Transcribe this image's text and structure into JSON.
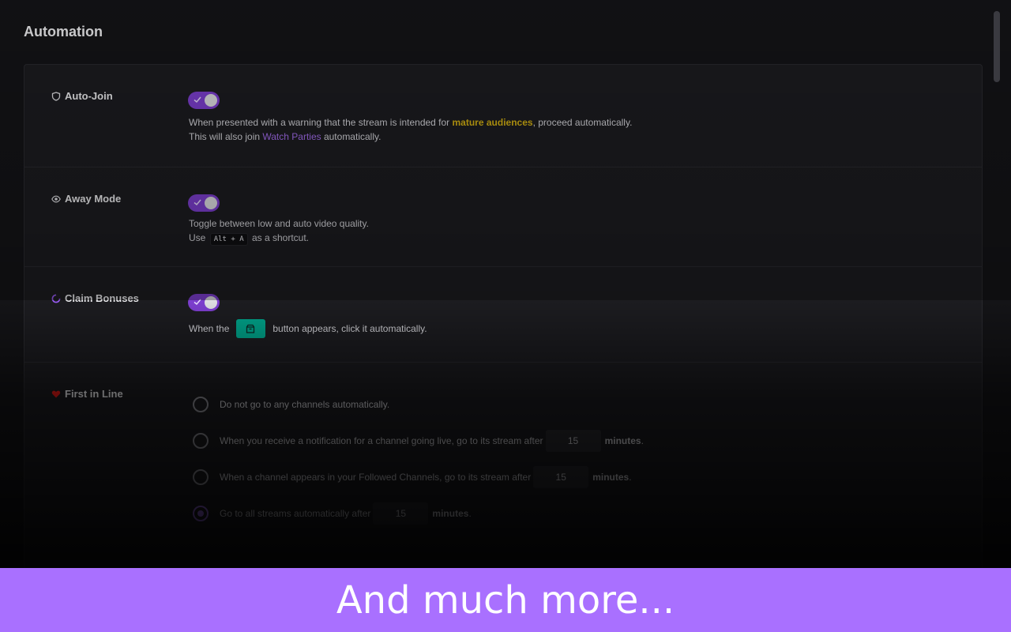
{
  "page": {
    "title": "Automation"
  },
  "colors": {
    "accent": "#7d3fd0",
    "mature": "#d4b012",
    "link": "#a56ef0",
    "banner": "#a970ff",
    "gift_button": "#00a38a"
  },
  "sections": {
    "auto_join": {
      "label": "Auto-Join",
      "icon": "shield-icon",
      "toggle_on": true,
      "desc_line1_a": "When presented with a warning that the stream is intended for ",
      "desc_line1_b": "mature audiences",
      "desc_line1_c": ", proceed automatically.",
      "desc_line2_a": "This will also join ",
      "desc_line2_link": "Watch Parties",
      "desc_line2_c": " automatically."
    },
    "away_mode": {
      "label": "Away Mode",
      "icon": "eye-icon",
      "toggle_on": true,
      "desc_line1": "Toggle between low and auto video quality.",
      "desc_line2_a": "Use",
      "shortcut": "Alt + A",
      "desc_line2_c": "as a shortcut."
    },
    "claim_bonuses": {
      "label": "Claim Bonuses",
      "icon": "bonus-icon",
      "toggle_on": true,
      "desc_a": "When the",
      "button_icon": "gift-icon",
      "desc_c": "button appears, click it automatically."
    },
    "first_in_line": {
      "label": "First in Line",
      "icon": "heart-icon",
      "options": [
        {
          "text": "Do not go to any channels automatically.",
          "checked": false
        },
        {
          "text": "When you receive a notification for a channel going live, go to its stream after",
          "value": "15",
          "unit": "minutes",
          "suffix": ".",
          "checked": false
        },
        {
          "text": "When a channel appears in your Followed Channels, go to its stream after",
          "value": "15",
          "unit": "minutes",
          "suffix": ".",
          "checked": false
        },
        {
          "text": "Go to all streams automatically after",
          "value": "15",
          "unit": "minutes",
          "suffix": ".",
          "checked": true
        }
      ]
    }
  },
  "banner": {
    "text": "And much more..."
  }
}
